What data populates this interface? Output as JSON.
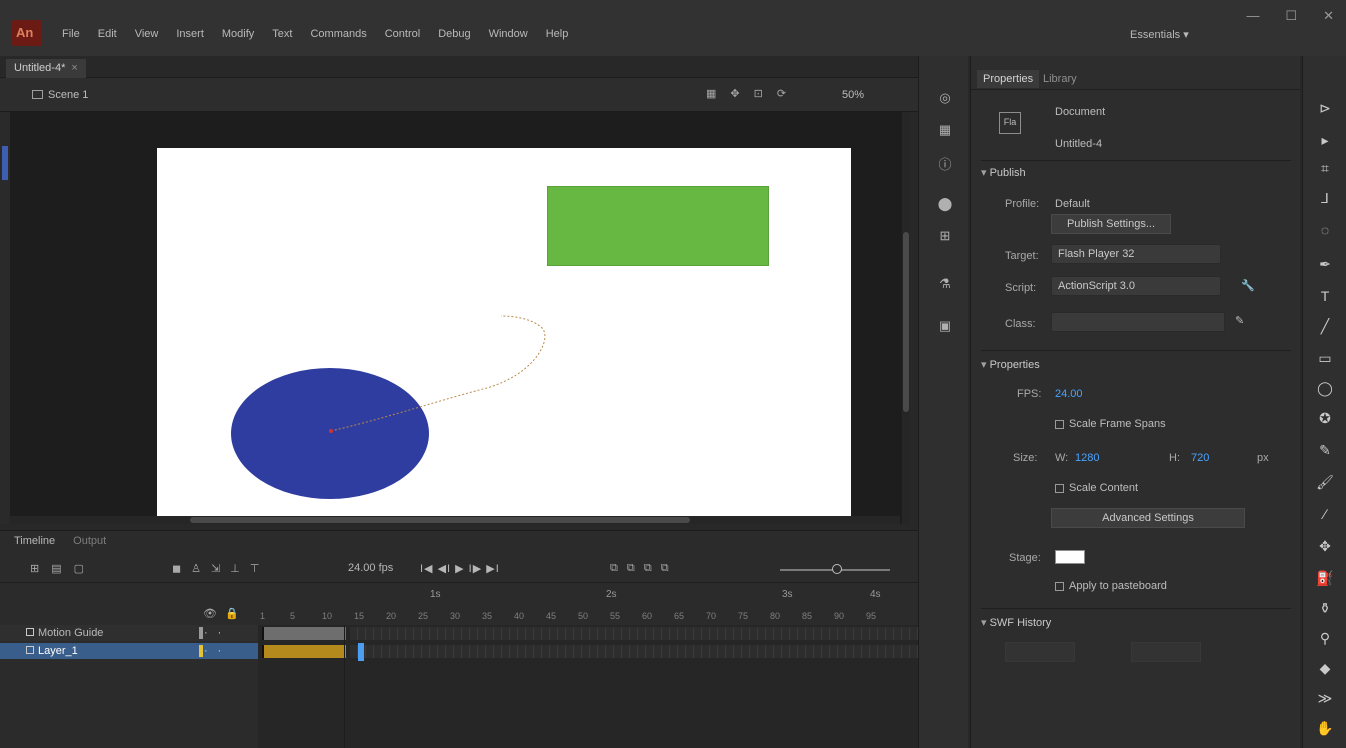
{
  "menu": {
    "logo": "An",
    "items": [
      "File",
      "Edit",
      "View",
      "Insert",
      "Modify",
      "Text",
      "Commands",
      "Control",
      "Debug",
      "Window",
      "Help"
    ],
    "workspace": "Essentials ▾",
    "window_controls": [
      "—",
      "☐",
      "✕"
    ]
  },
  "document": {
    "tab_label": "Untitled-4*",
    "tab_close": "×"
  },
  "editbar": {
    "scene": "Scene 1",
    "zoom": "50%"
  },
  "timeline": {
    "tabs": [
      "Timeline",
      "Output"
    ],
    "fps": "24.00 fps",
    "playback": "I◀ ◀I ▶ I▶ ▶I",
    "onion": "⧉ ⧉ ⧉ ⧉",
    "ruler_numbers": [
      "1s",
      "2s",
      "3s",
      "4s"
    ],
    "frame_numbers": [
      "1",
      "5",
      "10",
      "15",
      "20",
      "25",
      "30",
      "35",
      "40",
      "45",
      "50",
      "55",
      "60",
      "65",
      "70",
      "75",
      "80",
      "85",
      "90",
      "95"
    ],
    "layers": [
      {
        "name": "Motion Guide",
        "color": "#9a9a9a"
      },
      {
        "name": "Layer_1",
        "color": "#e6c13a"
      }
    ]
  },
  "properties": {
    "tabs": [
      "Properties",
      "Library"
    ],
    "doc_type": "Document",
    "doc_name": "Untitled-4",
    "publish": {
      "heading": "Publish",
      "profile_label": "Profile:",
      "profile_value": "Default",
      "settings_button": "Publish Settings...",
      "target_label": "Target:",
      "target_value": "Flash Player 32",
      "script_label": "Script:",
      "script_value": "ActionScript 3.0",
      "class_label": "Class:",
      "class_value": ""
    },
    "document_props": {
      "heading": "Properties",
      "fps_label": "FPS:",
      "fps_value": "24.00",
      "scale_spans": "Scale Frame Spans",
      "size_label": "Size:",
      "width_label": "W:",
      "width_value": "1280",
      "height_label": "H:",
      "height_value": "720",
      "unit": "px",
      "scale_content": "Scale Content",
      "advanced_button": "Advanced Settings",
      "stage_label": "Stage:",
      "stage_color": "#ffffff",
      "apply_pasteboard": "Apply to pasteboard"
    },
    "swf_history": {
      "heading": "SWF History"
    }
  }
}
